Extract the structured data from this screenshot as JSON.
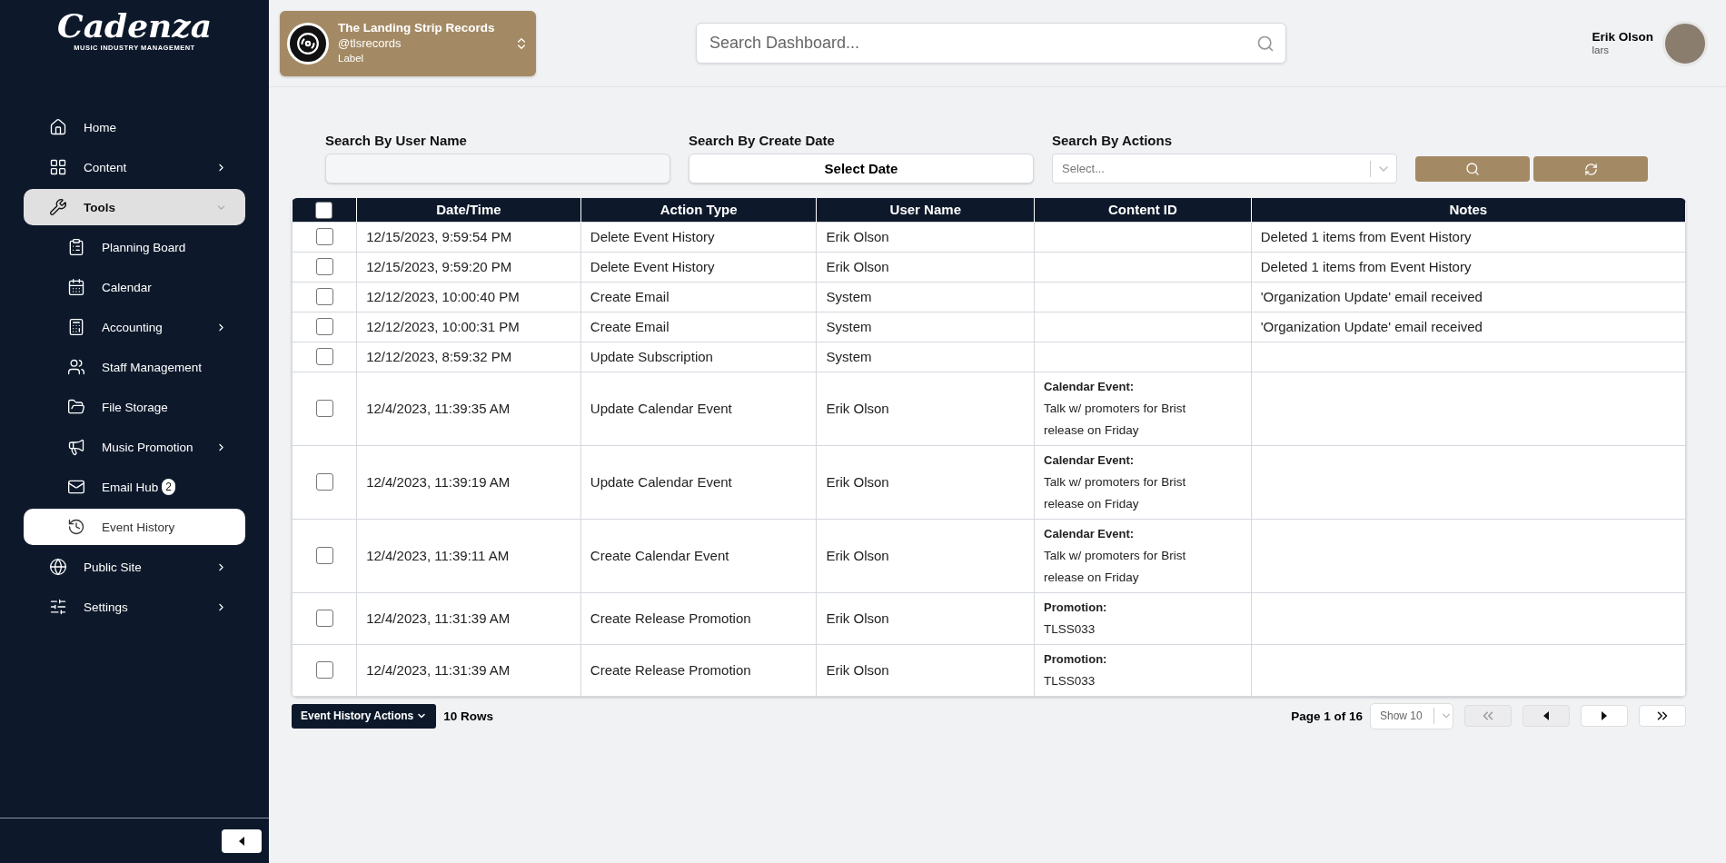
{
  "brand": {
    "name": "Cadenza",
    "tagline": "MUSIC INDUSTRY MANAGEMENT"
  },
  "sidebar": {
    "items": [
      {
        "label": "Home",
        "has_submenu": false,
        "expanded": false,
        "selected": false
      },
      {
        "label": "Content",
        "has_submenu": true,
        "expanded": false,
        "selected": false
      },
      {
        "label": "Tools",
        "has_submenu": true,
        "expanded": true,
        "selected": false,
        "children": [
          {
            "label": "Planning Board",
            "has_submenu": false,
            "selected": false
          },
          {
            "label": "Calendar",
            "has_submenu": false,
            "selected": false
          },
          {
            "label": "Accounting",
            "has_submenu": true,
            "selected": false
          },
          {
            "label": "Staff Management",
            "has_submenu": false,
            "selected": false
          },
          {
            "label": "File Storage",
            "has_submenu": false,
            "selected": false
          },
          {
            "label": "Music Promotion",
            "has_submenu": true,
            "selected": false
          },
          {
            "label": "Email Hub",
            "has_submenu": false,
            "selected": false,
            "badge": "2"
          },
          {
            "label": "Event History",
            "has_submenu": false,
            "selected": true
          }
        ]
      },
      {
        "label": "Public Site",
        "has_submenu": true,
        "expanded": false,
        "selected": false
      },
      {
        "label": "Settings",
        "has_submenu": true,
        "expanded": false,
        "selected": false
      }
    ]
  },
  "account": {
    "name": "The Landing Strip Records",
    "handle": "@tlsrecords",
    "type": "Label"
  },
  "search": {
    "placeholder": "Search Dashboard..."
  },
  "user": {
    "name": "Erik Olson",
    "username": "lars"
  },
  "filters": [
    {
      "kind": "text",
      "label": "Search By User Name"
    },
    {
      "kind": "date",
      "label": "Search By Create Date",
      "value": "Select Date"
    },
    {
      "kind": "select",
      "label": "Search By Actions",
      "placeholder": "Select..."
    }
  ],
  "table": {
    "columns": [
      "Date/Time",
      "Action Type",
      "User Name",
      "Content ID",
      "Notes"
    ],
    "all_checked": false,
    "rows": [
      {
        "checked": false,
        "datetime": "12/15/2023, 9:59:54 PM",
        "action": "Delete Event History",
        "user": "Erik Olson",
        "notes": "Deleted 1 items from Event History"
      },
      {
        "checked": false,
        "datetime": "12/15/2023, 9:59:20 PM",
        "action": "Delete Event History",
        "user": "Erik Olson",
        "notes": "Deleted 1 items from Event History"
      },
      {
        "checked": false,
        "datetime": "12/12/2023, 10:00:40 PM",
        "action": "Create Email",
        "user": "System",
        "notes": "'Organization Update' email received"
      },
      {
        "checked": false,
        "datetime": "12/12/2023, 10:00:31 PM",
        "action": "Create Email",
        "user": "System",
        "notes": "'Organization Update' email received"
      },
      {
        "checked": false,
        "datetime": "12/12/2023, 8:59:32 PM",
        "action": "Update Subscription",
        "user": "System"
      },
      {
        "checked": false,
        "datetime": "12/4/2023, 11:39:35 AM",
        "action": "Update Calendar Event",
        "user": "Erik Olson",
        "content": {
          "label": "Calendar Event:",
          "text": "Talk w/ promoters for Brist release on Friday"
        }
      },
      {
        "checked": false,
        "datetime": "12/4/2023, 11:39:19 AM",
        "action": "Update Calendar Event",
        "user": "Erik Olson",
        "content": {
          "label": "Calendar Event:",
          "text": "Talk w/ promoters for Brist release on Friday"
        }
      },
      {
        "checked": false,
        "datetime": "12/4/2023, 11:39:11 AM",
        "action": "Create Calendar Event",
        "user": "Erik Olson",
        "content": {
          "label": "Calendar Event:",
          "text": "Talk w/ promoters for Brist release on Friday"
        }
      },
      {
        "checked": false,
        "datetime": "12/4/2023, 11:31:39 AM",
        "action": "Create Release Promotion",
        "user": "Erik Olson",
        "content": {
          "label": "Promotion:",
          "text": "TLSS033"
        }
      },
      {
        "checked": false,
        "datetime": "12/4/2023, 11:31:39 AM",
        "action": "Create Release Promotion",
        "user": "Erik Olson",
        "content": {
          "label": "Promotion:",
          "text": "TLSS033"
        }
      }
    ]
  },
  "footer": {
    "actions_label": "Event History Actions",
    "row_count": "10 Rows",
    "page": "Page 1 of 16",
    "page_size": "Show 10",
    "pager": [
      {
        "kind": "first",
        "disabled": true
      },
      {
        "kind": "prev",
        "disabled": true
      },
      {
        "kind": "next",
        "disabled": false
      },
      {
        "kind": "last",
        "disabled": false
      }
    ]
  }
}
